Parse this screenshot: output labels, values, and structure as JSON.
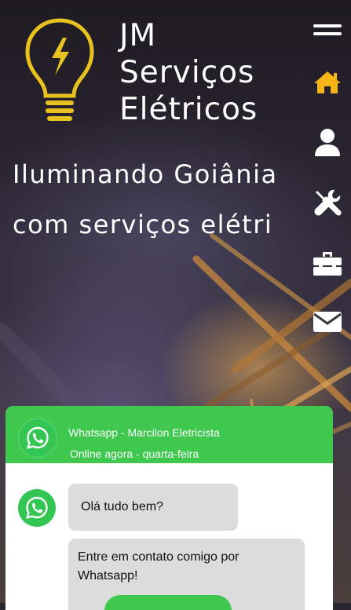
{
  "brand": {
    "line1": "JM",
    "line2": "Serviços",
    "line3": "Elétricos",
    "logo_icon": "lightbulb-bolt-icon",
    "logo_color": "#e8c21e"
  },
  "hero": {
    "tagline_line1": "Iluminando Goiânia",
    "tagline_line2": "com serviços elétri"
  },
  "nav": {
    "items": [
      {
        "icon": "menu-icon",
        "active": false
      },
      {
        "icon": "home-icon",
        "active": true
      },
      {
        "icon": "user-icon",
        "active": false
      },
      {
        "icon": "tools-icon",
        "active": false
      },
      {
        "icon": "toolbox-icon",
        "active": false
      },
      {
        "icon": "envelope-icon",
        "active": false
      }
    ],
    "active_color": "#f5b516",
    "icon_color": "#ffffff"
  },
  "chat": {
    "title": "Whatsapp - Marcilon Eletricista",
    "status": "Online agora - quarta-feira",
    "messages": [
      "Olá tudo bem?",
      "Entre em contato comigo por Whatsapp!"
    ],
    "cta_label": "",
    "header_color": "#3ec94e",
    "bubble_color": "#dcdcdc"
  }
}
